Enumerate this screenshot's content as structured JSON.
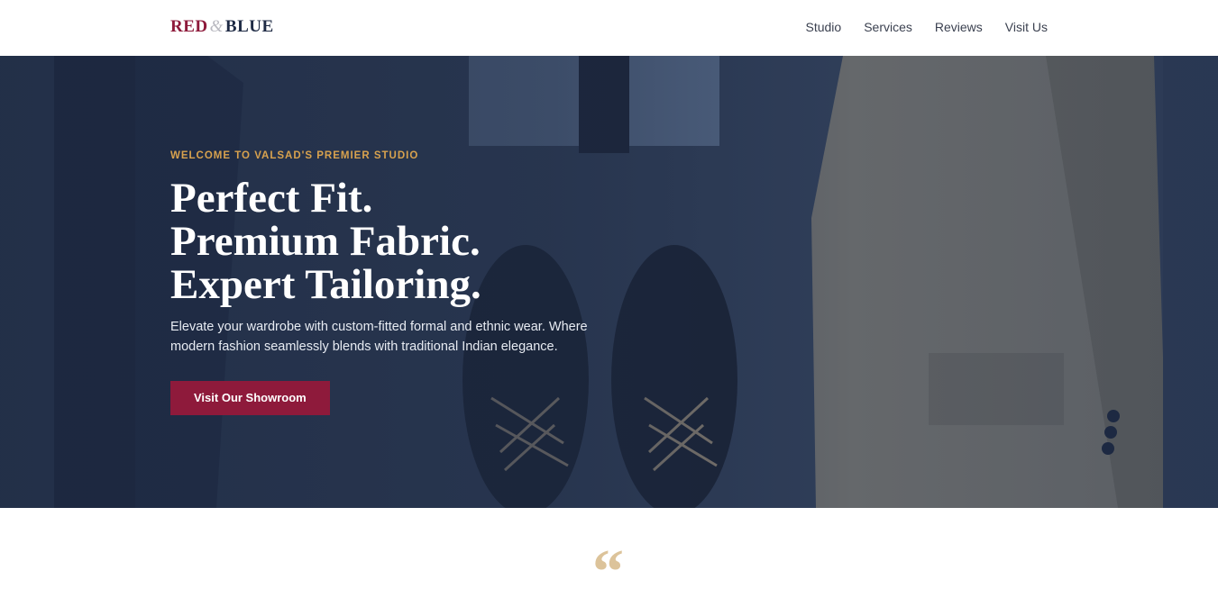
{
  "brand": {
    "part1": "RED",
    "amp": "&",
    "part2": "BLUE"
  },
  "nav": {
    "items": [
      "Studio",
      "Services",
      "Reviews",
      "Visit Us"
    ]
  },
  "hero": {
    "eyebrow": "WELCOME TO VALSAD'S PREMIER STUDIO",
    "headline": [
      "Perfect Fit.",
      "Premium Fabric.",
      "Expert Tailoring."
    ],
    "subtext": "Elevate your wardrobe with custom-fitted formal and ethnic wear. Where modern fashion seamlessly blends with traditional Indian elegance.",
    "cta_label": "Visit Our Showroom"
  },
  "testimonial": {
    "quote_glyph": "“"
  },
  "colors": {
    "accent_red": "#8e1a3b",
    "navy": "#1e2a44",
    "gold": "#d8a24e"
  },
  "icons": {
    "background": "hero-photo-suit-shoes"
  }
}
